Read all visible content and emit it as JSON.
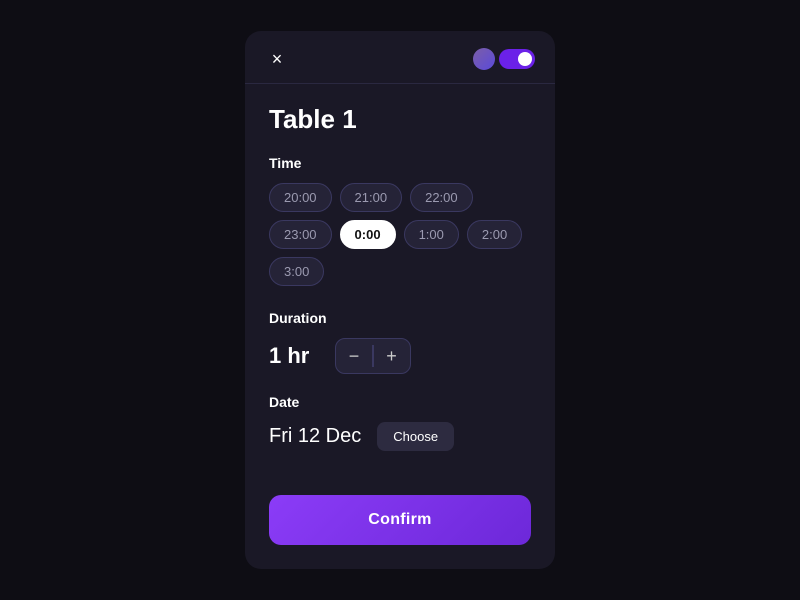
{
  "modal": {
    "title": "Table 1",
    "close_icon": "×",
    "time_section": {
      "label": "Time",
      "options": [
        "20:00",
        "21:00",
        "22:00",
        "23:00",
        "0:00",
        "1:00",
        "2:00",
        "3:00"
      ],
      "selected": "0:00"
    },
    "duration_section": {
      "label": "Duration",
      "value": "1 hr",
      "decrement_icon": "−",
      "increment_icon": "+"
    },
    "date_section": {
      "label": "Date",
      "value": "Fri 12 Dec",
      "choose_label": "Choose"
    },
    "confirm_label": "Confirm"
  }
}
